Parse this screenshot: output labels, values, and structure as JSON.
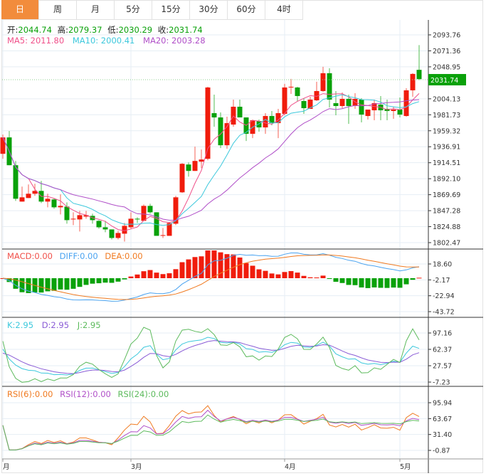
{
  "tabs": [
    {
      "label": "日",
      "active": true
    },
    {
      "label": "周"
    },
    {
      "label": "月"
    },
    {
      "label": "5分"
    },
    {
      "label": "15分"
    },
    {
      "label": "30分"
    },
    {
      "label": "60分"
    },
    {
      "label": "4时"
    }
  ],
  "ohlc_legend": {
    "open_label": "开:",
    "open": "2044.74",
    "high_label": "高:",
    "high": "2079.37",
    "low_label": "低:",
    "low": "2030.29",
    "close_label": "收:",
    "close": "2031.74"
  },
  "ma_legend": {
    "ma5": "MA5: 2011.80",
    "ma10": "MA10: 2000.41",
    "ma20": "MA20: 2003.28"
  },
  "macd_legend": {
    "macd": "MACD:0.00",
    "diff": "DIFF:0.00",
    "dea": "DEA:0.00"
  },
  "kdj_legend": {
    "k": "K:2.95",
    "d": "D:2.95",
    "j": "J:2.95"
  },
  "rsi_legend": {
    "rsi6": "RSI(6):0.00",
    "rsi12": "RSI(12):0.00",
    "rsi24": "RSI(24):0.00"
  },
  "price_axis": [
    "2093.76",
    "2071.36",
    "2048.95",
    "2004.13",
    "1981.73",
    "1959.32",
    "1936.91",
    "1914.51",
    "1892.10",
    "1869.69",
    "1847.28",
    "1824.88",
    "1802.47"
  ],
  "price_tag": "2031.74",
  "macd_axis": [
    "18.60",
    "-2.17",
    "-22.94",
    "-43.72"
  ],
  "kdj_axis": [
    "97.16",
    "62.37",
    "27.57",
    "-7.23"
  ],
  "rsi_axis": [
    "95.94",
    "63.67",
    "31.40",
    "-0.87"
  ],
  "x_axis": [
    {
      "label": "月",
      "index": 0
    },
    {
      "label": "3月",
      "index": 20
    },
    {
      "label": "4月",
      "index": 44
    },
    {
      "label": "5月",
      "index": 62
    }
  ],
  "colors": {
    "up": "#f01c0c",
    "down": "#0aa10a",
    "ma5": "#f0508a",
    "ma10": "#3cc8dc",
    "ma20": "#b04fc8",
    "diff": "#4aa3f0",
    "dea": "#f07a20",
    "k": "#3cc8dc",
    "d": "#8a5cd6",
    "j": "#5cba5c",
    "rsi6": "#f07a20",
    "rsi12": "#b04fc8",
    "rsi24": "#5cba5c",
    "active_tab": "#f28c3c"
  },
  "chart_data": {
    "type": "candlestick",
    "fields": [
      "open",
      "high",
      "low",
      "close"
    ],
    "candles": [
      [
        1927,
        1954,
        1920,
        1950
      ],
      [
        1950,
        1959,
        1911,
        1911
      ],
      [
        1911,
        1917,
        1861,
        1864
      ],
      [
        1860,
        1881,
        1860,
        1866
      ],
      [
        1865,
        1884,
        1865,
        1871
      ],
      [
        1871,
        1885,
        1868,
        1875
      ],
      [
        1875,
        1889,
        1858,
        1860
      ],
      [
        1860,
        1871,
        1852,
        1864
      ],
      [
        1863,
        1865,
        1850,
        1852
      ],
      [
        1852,
        1870,
        1842,
        1854
      ],
      [
        1853,
        1859,
        1829,
        1834
      ],
      [
        1835,
        1845,
        1827,
        1836
      ],
      [
        1835,
        1847,
        1818,
        1841
      ],
      [
        1839,
        1847,
        1836,
        1841
      ],
      [
        1840,
        1843,
        1829,
        1834
      ],
      [
        1833,
        1834,
        1822,
        1824
      ],
      [
        1824,
        1833,
        1817,
        1821
      ],
      [
        1821,
        1821,
        1807,
        1809
      ],
      [
        1809,
        1819,
        1807,
        1816
      ],
      [
        1815,
        1830,
        1804,
        1826
      ],
      [
        1824,
        1845,
        1822,
        1836
      ],
      [
        1836,
        1838,
        1830,
        1835
      ],
      [
        1833,
        1856,
        1833,
        1854
      ],
      [
        1854,
        1857,
        1843,
        1845
      ],
      [
        1845,
        1845,
        1812,
        1812
      ],
      [
        1812,
        1823,
        1809,
        1813
      ],
      [
        1812,
        1831,
        1812,
        1830
      ],
      [
        1829,
        1868,
        1827,
        1866
      ],
      [
        1873,
        1914,
        1872,
        1913
      ],
      [
        1912,
        1915,
        1895,
        1903
      ],
      [
        1903,
        1937,
        1903,
        1917
      ],
      [
        1916,
        1933,
        1907,
        1919
      ],
      [
        1920,
        2021,
        1918,
        2020
      ],
      [
        1984,
        2010,
        1965,
        1978
      ],
      [
        1978,
        1985,
        1935,
        1939
      ],
      [
        1939,
        1979,
        1934,
        1970
      ],
      [
        1968,
        2003,
        1965,
        1993
      ],
      [
        1993,
        2003,
        1978,
        1978
      ],
      [
        1978,
        1978,
        1945,
        1955
      ],
      [
        1955,
        1975,
        1949,
        1974
      ],
      [
        1973,
        1975,
        1958,
        1964
      ],
      [
        1964,
        1984,
        1955,
        1980
      ],
      [
        1980,
        1987,
        1967,
        1970
      ],
      [
        1970,
        1990,
        1949,
        1984
      ],
      [
        1983,
        2025,
        1981,
        2020
      ],
      [
        2020,
        2032,
        2011,
        2021
      ],
      [
        2020,
        2021,
        2001,
        2008
      ],
      [
        2001,
        2005,
        1983,
        1991
      ],
      [
        1990,
        2007,
        1990,
        2003
      ],
      [
        2002,
        2028,
        2001,
        2015
      ],
      [
        2015,
        2049,
        2014,
        2040
      ],
      [
        2040,
        2047,
        1992,
        2003
      ],
      [
        1998,
        2015,
        1981,
        1994
      ],
      [
        1994,
        2013,
        1991,
        2004
      ],
      [
        2004,
        2010,
        1969,
        1994
      ],
      [
        1994,
        2012,
        1990,
        2004
      ],
      [
        2003,
        2005,
        1971,
        1982
      ],
      [
        1980,
        1989,
        1975,
        1989
      ],
      [
        1988,
        2003,
        1974,
        1998
      ],
      [
        1996,
        2008,
        1974,
        1988
      ],
      [
        1990,
        2003,
        1974,
        1987
      ],
      [
        1987,
        1993,
        1976,
        1989
      ],
      [
        1989,
        2006,
        1978,
        1982
      ],
      [
        1980,
        2019,
        1979,
        2016
      ],
      [
        2016,
        2040,
        2007,
        2039
      ],
      [
        2044.74,
        2079.37,
        2030.29,
        2031.74
      ]
    ],
    "moving_averages": [
      "MA5",
      "MA10",
      "MA20"
    ],
    "indicators": [
      "MACD",
      "KDJ",
      "RSI"
    ]
  }
}
